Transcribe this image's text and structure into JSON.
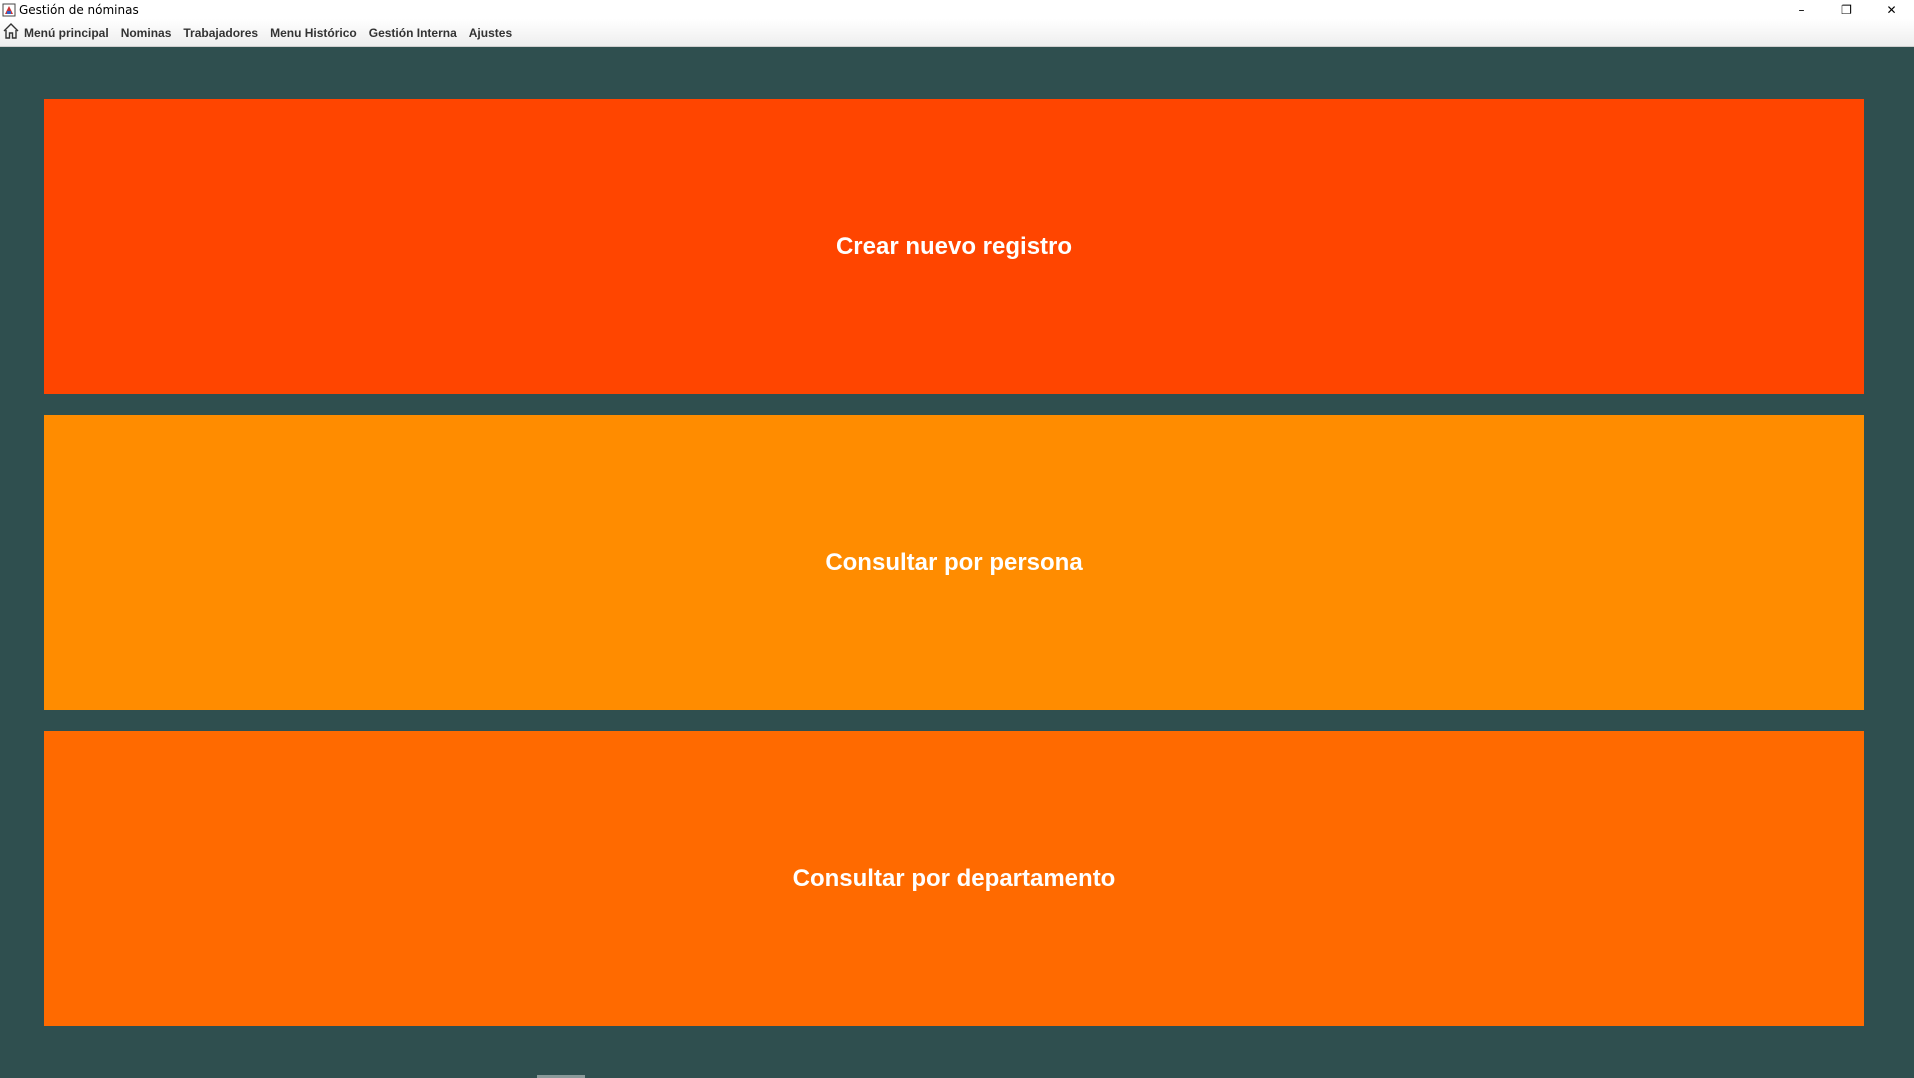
{
  "window": {
    "title": "Gestión de nóminas",
    "controls": {
      "minimize": "–",
      "restore": "❐",
      "close": "✕"
    }
  },
  "menubar": {
    "items": [
      {
        "label": "Menú principal",
        "icon": "home-icon"
      },
      {
        "label": "Nominas"
      },
      {
        "label": "Trabajadores"
      },
      {
        "label": "Menu Histórico"
      },
      {
        "label": "Gestión Interna"
      },
      {
        "label": "Ajustes"
      }
    ]
  },
  "main": {
    "buttons": [
      {
        "label": "Crear nuevo registro",
        "color": "#ff4500"
      },
      {
        "label": "Consultar por persona",
        "color": "#ff8c00"
      },
      {
        "label": "Consultar por departamento",
        "color": "#ff6a00"
      }
    ]
  },
  "colors": {
    "background": "#2f4f4f",
    "button_text": "#ffffff"
  }
}
